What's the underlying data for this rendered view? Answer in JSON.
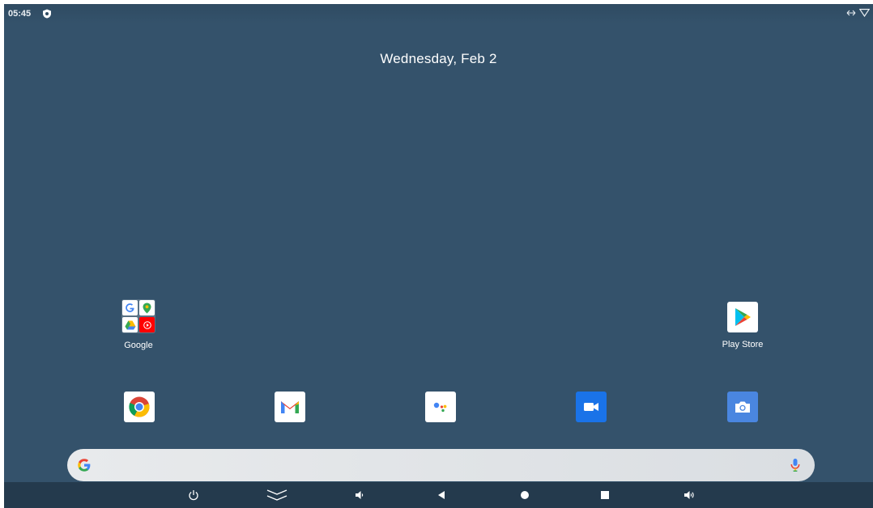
{
  "status_bar": {
    "time": "05:45",
    "icons": [
      "shield-icon",
      "data-arrows-icon",
      "wifi-icon"
    ]
  },
  "home": {
    "date": "Wednesday, Feb 2",
    "apps": [
      {
        "label": "Google",
        "icon": "google-folder-icon"
      },
      {
        "label": "Play Store",
        "icon": "play-store-icon"
      }
    ],
    "dock": [
      {
        "icon": "chrome-icon"
      },
      {
        "icon": "gmail-icon"
      },
      {
        "icon": "assistant-icon"
      },
      {
        "icon": "meet-icon"
      },
      {
        "icon": "camera-icon"
      }
    ]
  },
  "search_bar": {
    "icons": [
      "google-g-icon",
      "mic-icon"
    ]
  },
  "nav_bar": {
    "buttons": [
      "power-icon",
      "collapse-icon",
      "volume-down-icon",
      "back-icon",
      "home-icon",
      "recents-icon",
      "volume-up-icon"
    ]
  },
  "colors": {
    "wallpaper": "#34526b",
    "navbar": "#243a4d"
  }
}
